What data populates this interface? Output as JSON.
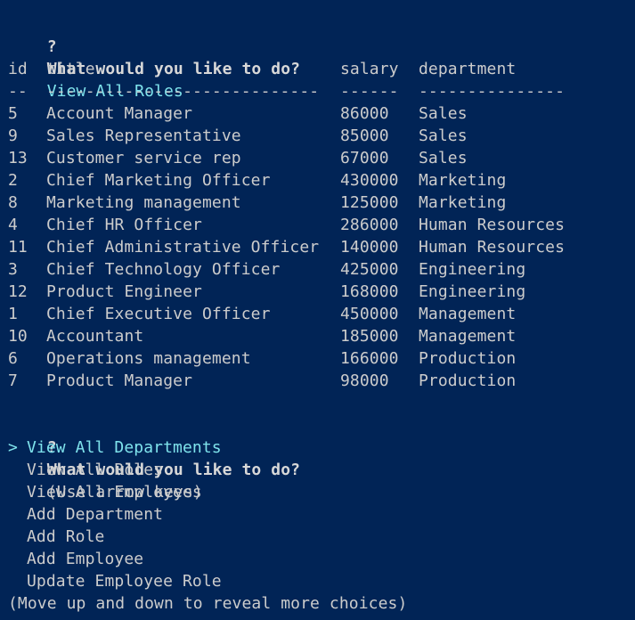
{
  "prompt1": {
    "marker": "?",
    "question": "What would you like to do?",
    "answer": "View All Roles"
  },
  "table": {
    "headers": [
      "id",
      "title",
      "salary",
      "department"
    ],
    "separators": [
      "--",
      "----------------------------",
      "------",
      "---------------"
    ],
    "rows": [
      [
        "5",
        "Account Manager",
        "86000",
        "Sales"
      ],
      [
        "9",
        "Sales Representative",
        "85000",
        "Sales"
      ],
      [
        "13",
        "Customer service rep",
        "67000",
        "Sales"
      ],
      [
        "2",
        "Chief Marketing Officer",
        "430000",
        "Marketing"
      ],
      [
        "8",
        "Marketing management",
        "125000",
        "Marketing"
      ],
      [
        "4",
        "Chief HR Officer",
        "286000",
        "Human Resources"
      ],
      [
        "11",
        "Chief Administrative Officer",
        "140000",
        "Human Resources"
      ],
      [
        "3",
        "Chief Technology Officer",
        "425000",
        "Engineering"
      ],
      [
        "12",
        "Product Engineer",
        "168000",
        "Engineering"
      ],
      [
        "1",
        "Chief Executive Officer",
        "450000",
        "Management"
      ],
      [
        "10",
        "Accountant",
        "185000",
        "Management"
      ],
      [
        "6",
        "Operations management",
        "166000",
        "Production"
      ],
      [
        "7",
        "Product Manager",
        "98000",
        "Production"
      ]
    ]
  },
  "prompt2": {
    "marker": "?",
    "question": "What would you like to do?",
    "hint": "(Use arrow keys)",
    "pointer": ">",
    "choices": [
      "View All Departments",
      "View All Roles",
      "View All Employees",
      "Add Department",
      "Add Role",
      "Add Employee",
      "Update Employee Role"
    ],
    "footer": "(Move up and down to reveal more choices)"
  },
  "colors": {
    "background": "#012456",
    "text": "#cccccc",
    "highlight": "#7fe3ec"
  }
}
